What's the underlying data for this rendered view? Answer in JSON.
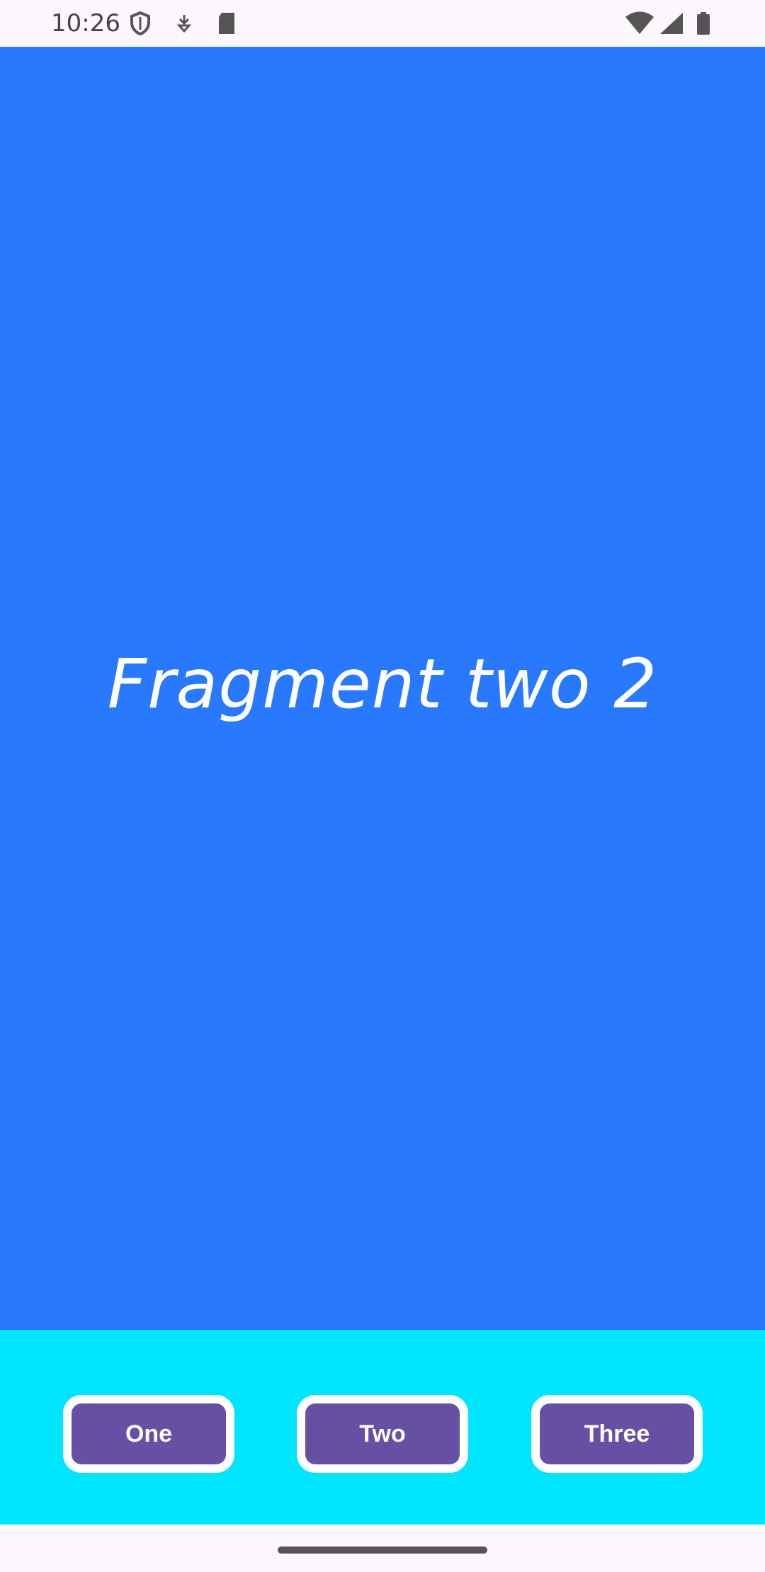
{
  "status_bar": {
    "time": "10:26",
    "icons_left": [
      "shield-icon",
      "download-icon",
      "sd-card-icon"
    ],
    "icons_right": [
      "wifi-icon",
      "signal-icon",
      "battery-icon"
    ]
  },
  "content": {
    "title": "Fragment two 2",
    "background_color": "#2979FF"
  },
  "buttons": {
    "one_label": "One",
    "two_label": "Two",
    "three_label": "Three",
    "bar_color": "#00E5FF",
    "button_color": "#6750A4"
  }
}
